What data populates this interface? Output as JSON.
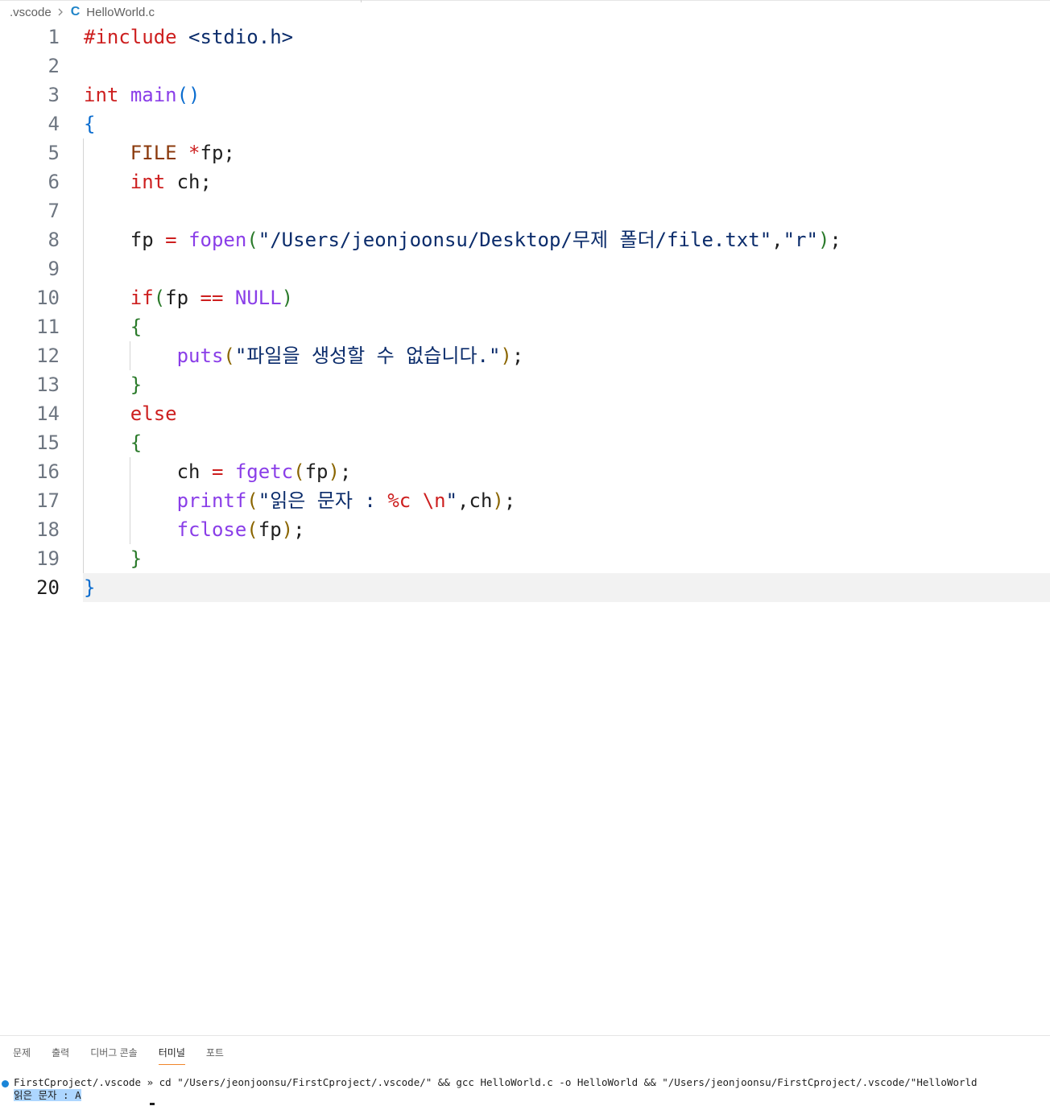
{
  "breadcrumb": {
    "folder": ".vscode",
    "separator_icon": "chevron-right-icon",
    "file_icon": "c-language-icon",
    "file_icon_glyph": "C",
    "file": "HelloWorld.c"
  },
  "editor": {
    "active_line": 20,
    "lines": [
      {
        "n": "1",
        "t": [
          [
            "#include",
            "pp"
          ],
          [
            " ",
            "pl"
          ],
          [
            "<stdio.h>",
            "hdr"
          ]
        ]
      },
      {
        "n": "2",
        "t": []
      },
      {
        "n": "3",
        "t": [
          [
            "int",
            "kw"
          ],
          [
            " ",
            "pl"
          ],
          [
            "main",
            "fn"
          ],
          [
            "()",
            "b1"
          ]
        ]
      },
      {
        "n": "4",
        "t": [
          [
            "{",
            "b1"
          ]
        ]
      },
      {
        "n": "5",
        "t": [
          [
            "    ",
            "pl"
          ],
          [
            "FILE",
            "ty"
          ],
          [
            " ",
            "pl"
          ],
          [
            "*",
            "op"
          ],
          [
            "fp;",
            "pl"
          ]
        ]
      },
      {
        "n": "6",
        "t": [
          [
            "    ",
            "pl"
          ],
          [
            "int",
            "kw"
          ],
          [
            " ch;",
            "pl"
          ]
        ]
      },
      {
        "n": "7",
        "t": []
      },
      {
        "n": "8",
        "t": [
          [
            "    fp ",
            "pl"
          ],
          [
            "=",
            "op"
          ],
          [
            " ",
            "pl"
          ],
          [
            "fopen",
            "fn"
          ],
          [
            "(",
            "b2"
          ],
          [
            "\"/Users/jeonjoonsu/Desktop/무제 폴더/file.txt\"",
            "st"
          ],
          [
            ",",
            "pl"
          ],
          [
            "\"r\"",
            "st"
          ],
          [
            ")",
            "b2"
          ],
          [
            ";",
            "pl"
          ]
        ]
      },
      {
        "n": "9",
        "t": []
      },
      {
        "n": "10",
        "t": [
          [
            "    ",
            "pl"
          ],
          [
            "if",
            "kw"
          ],
          [
            "(",
            "b2"
          ],
          [
            "fp ",
            "pl"
          ],
          [
            "==",
            "op"
          ],
          [
            " ",
            "pl"
          ],
          [
            "NULL",
            "nl"
          ],
          [
            ")",
            "b2"
          ]
        ]
      },
      {
        "n": "11",
        "t": [
          [
            "    ",
            "pl"
          ],
          [
            "{",
            "b2"
          ]
        ]
      },
      {
        "n": "12",
        "t": [
          [
            "        ",
            "pl"
          ],
          [
            "puts",
            "fn"
          ],
          [
            "(",
            "b3"
          ],
          [
            "\"파일을 생성할 수 없습니다.\"",
            "st"
          ],
          [
            ")",
            "b3"
          ],
          [
            ";",
            "pl"
          ]
        ]
      },
      {
        "n": "13",
        "t": [
          [
            "    ",
            "pl"
          ],
          [
            "}",
            "b2"
          ]
        ]
      },
      {
        "n": "14",
        "t": [
          [
            "    ",
            "pl"
          ],
          [
            "else",
            "kw"
          ]
        ]
      },
      {
        "n": "15",
        "t": [
          [
            "    ",
            "pl"
          ],
          [
            "{",
            "b2"
          ]
        ]
      },
      {
        "n": "16",
        "t": [
          [
            "        ch ",
            "pl"
          ],
          [
            "=",
            "op"
          ],
          [
            " ",
            "pl"
          ],
          [
            "fgetc",
            "fn"
          ],
          [
            "(",
            "b3"
          ],
          [
            "fp",
            "pl"
          ],
          [
            ")",
            "b3"
          ],
          [
            ";",
            "pl"
          ]
        ]
      },
      {
        "n": "17",
        "t": [
          [
            "        ",
            "pl"
          ],
          [
            "printf",
            "fn"
          ],
          [
            "(",
            "b3"
          ],
          [
            "\"읽은 문자 : ",
            "st"
          ],
          [
            "%c",
            "es"
          ],
          [
            " ",
            "st"
          ],
          [
            "\\n",
            "es"
          ],
          [
            "\"",
            "st"
          ],
          [
            ",ch",
            "pl"
          ],
          [
            ")",
            "b3"
          ],
          [
            ";",
            "pl"
          ]
        ]
      },
      {
        "n": "18",
        "t": [
          [
            "        ",
            "pl"
          ],
          [
            "fclose",
            "fn"
          ],
          [
            "(",
            "b3"
          ],
          [
            "fp",
            "pl"
          ],
          [
            ")",
            "b3"
          ],
          [
            ";",
            "pl"
          ]
        ]
      },
      {
        "n": "19",
        "t": [
          [
            "    ",
            "pl"
          ],
          [
            "}",
            "b2"
          ]
        ]
      },
      {
        "n": "20",
        "t": [
          [
            "}",
            "b1"
          ]
        ]
      }
    ]
  },
  "panel": {
    "tabs": [
      "문제",
      "출력",
      "디버그 콘솔",
      "터미널",
      "포트"
    ],
    "active_tab": "터미널",
    "terminal": {
      "status_color": "#1a85d8",
      "command_line": "FirstCproject/.vscode » cd \"/Users/jeonjoonsu/FirstCproject/.vscode/\" && gcc HelloWorld.c -o HelloWorld && \"/Users/jeonjoonsu/FirstCproject/.vscode/\"HelloWorld",
      "output_line": "읽은 문자 : A"
    }
  }
}
